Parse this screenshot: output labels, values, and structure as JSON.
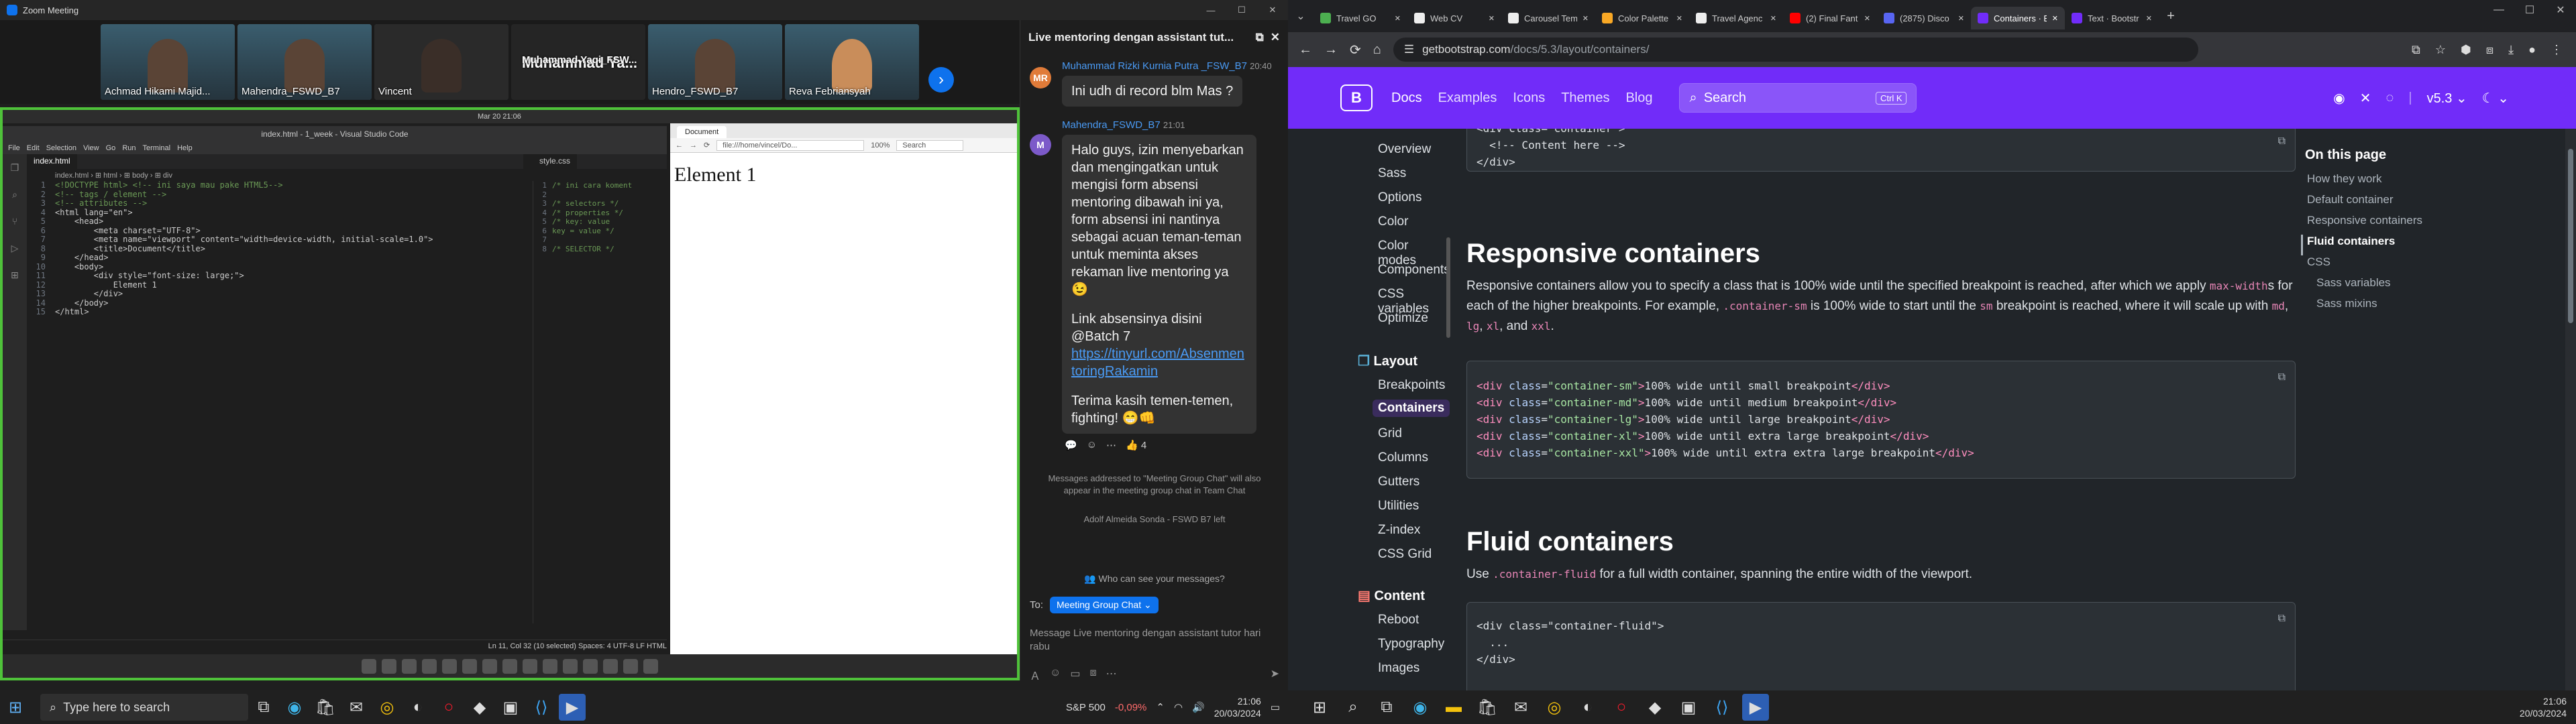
{
  "zoom": {
    "window_title": "Zoom Meeting",
    "participants": [
      {
        "name": "Achmad Hikami Majid..."
      },
      {
        "name": "Mahendra_FSWD_B7"
      },
      {
        "name": "Vincent"
      },
      {
        "name": "Muhammad  Ya..."
      },
      {
        "name": "Muhammad Yaqi_FSW..."
      },
      {
        "name": "Hendro_FSWD_B7"
      },
      {
        "name": "Reva Febriansyah"
      }
    ],
    "chat": {
      "title": "Live mentoring dengan assistant tut...",
      "msg1": {
        "avatar": "MR",
        "sender": "Muhammad Rizki Kurnia Putra _FSW_B7",
        "time": "20:40",
        "text": "Ini udh di record blm Mas ?"
      },
      "msg2": {
        "avatar": "M",
        "sender": "Mahendra_FSWD_B7",
        "time": "21:01",
        "p1": "Halo guys, izin menyebarkan dan mengingatkan untuk mengisi form absensi mentoring dibawah ini ya, form absensi ini nantinya sebagai acuan teman-teman untuk meminta akses rekaman live mentoring ya 😉",
        "p2": "Link absensinya disini @Batch 7",
        "link": "https://tinyurl.com/AbsenmentoringRakamin",
        "p3": "Terima kasih temen-temen, fighting! 😁👊",
        "reaction": "👍 4"
      },
      "note": "Messages addressed to \"Meeting Group Chat\" will also appear in the meeting group chat in Team Chat",
      "left_note": "Adolf Almeida Sonda - FSWD B7 left",
      "who_can_see": "Who can see your messages?",
      "to_label": "To:",
      "to_value": "Meeting Group Chat ⌄",
      "input_placeholder": "Message Live mentoring dengan assistant tutor hari rabu"
    },
    "share": {
      "clock": "Mar 20  21:06",
      "vscode_title": "index.html - 1_week - Visual Studio Code",
      "menu": [
        "File",
        "Edit",
        "Selection",
        "View",
        "Go",
        "Run",
        "Terminal",
        "Help"
      ],
      "tab1": "index.html",
      "tab2": "style.css",
      "breadcrumb": "index.html › ⊞ html › ⊞ body › ⊞ div",
      "code_lines": [
        "<!DOCTYPE html> <!-- ini saya mau pake HTML5-->",
        "<!-- tags / element -->",
        "<!-- attributes -->",
        "<html lang=\"en\">",
        "    <head>",
        "        <meta charset=\"UTF-8\">",
        "        <meta name=\"viewport\" content=\"width=device-width, initial-scale=1.0\">",
        "        <title>Document</title>",
        "    </head>",
        "    <body>",
        "        <div style=\"font-size: large;\">",
        "            Element 1",
        "        </div>",
        "    </body>",
        "</html>"
      ],
      "css_lines": [
        "/* ini cara koment",
        "",
        "/* selectors */",
        "/* properties */",
        "/* key: value",
        "key = value */",
        "",
        "/* SELECTOR */"
      ],
      "status": "Ln 11, Col 32 (10 selected)   Spaces: 4   UTF-8   LF   HTML",
      "mini_tab": "Document",
      "mini_url": "file:///home/vincel/Do...",
      "mini_zoom": "100%",
      "mini_search": "Search",
      "mini_heading": "Element 1"
    }
  },
  "left_taskbar": {
    "search": "Type here to search",
    "stock": "S&P 500",
    "stock_change": "-0,09%",
    "time": "21:06",
    "date": "20/03/2024"
  },
  "browser": {
    "tabs": [
      {
        "title": "Travel GO",
        "color": "#4caf50"
      },
      {
        "title": "Web CV",
        "color": "#eeeeee"
      },
      {
        "title": "Carousel Tem",
        "color": "#eeeeee"
      },
      {
        "title": "Color Palette",
        "color": "#f9a825"
      },
      {
        "title": "Travel Agenc",
        "color": "#eeeeee"
      },
      {
        "title": "(2) Final Fant",
        "color": "#ff0000"
      },
      {
        "title": "(2875) Disco",
        "color": "#5865f2"
      },
      {
        "title": "Containers · B",
        "color": "#712cf9"
      },
      {
        "title": "Text · Bootstr",
        "color": "#712cf9"
      }
    ],
    "url_host": "getbootstrap.com",
    "url_path": "/docs/5.3/layout/containers/",
    "bs_nav": {
      "brand": "B",
      "links": [
        "Docs",
        "Examples",
        "Icons",
        "Themes",
        "Blog"
      ],
      "search": "Search",
      "search_kbd": "Ctrl K",
      "version": "v5.3"
    },
    "sidebar_top": [
      "Overview",
      "Sass",
      "Options",
      "Color",
      "Color modes",
      "Components",
      "CSS variables",
      "Optimize"
    ],
    "layout_head": "Layout",
    "layout_items": [
      "Breakpoints",
      "Containers",
      "Grid",
      "Columns",
      "Gutters",
      "Utilities",
      "Z-index",
      "CSS Grid"
    ],
    "content_head": "Content",
    "content_items": [
      "Reboot",
      "Typography",
      "Images"
    ],
    "code0": [
      "<div class=\"container\">",
      "  <!-- Content here -->",
      "</div>"
    ],
    "h_responsive": "Responsive containers",
    "p_responsive_1": "Responsive containers allow you to specify a class that is 100% wide until the specified breakpoint is reached, after which we apply",
    "p_responsive_c1": "max-width",
    "p_responsive_2": "s for each of the higher breakpoints. For example,",
    "p_responsive_c2": ".container-sm",
    "p_responsive_3": "is 100% wide to start until the",
    "p_responsive_c3": "sm",
    "p_responsive_4": "breakpoint is reached, where it will scale up with",
    "p_responsive_c4": "md",
    "p_responsive_c5": "lg",
    "p_responsive_c6": "xl",
    "p_responsive_and": ", and",
    "p_responsive_c7": "xxl",
    "code1": [
      {
        "cls": "container-sm",
        "text": "100% wide until small breakpoint"
      },
      {
        "cls": "container-md",
        "text": "100% wide until medium breakpoint"
      },
      {
        "cls": "container-lg",
        "text": "100% wide until large breakpoint"
      },
      {
        "cls": "container-xl",
        "text": "100% wide until extra large breakpoint"
      },
      {
        "cls": "container-xxl",
        "text": "100% wide until extra extra large breakpoint"
      }
    ],
    "h_fluid": "Fluid containers",
    "p_fluid_1": "Use",
    "p_fluid_c": ".container-fluid",
    "p_fluid_2": "for a full width container, spanning the entire width of the viewport.",
    "code2": [
      "<div class=\"container-fluid\">",
      "  ...",
      "</div>"
    ],
    "on_this_page": {
      "title": "On this page",
      "items": [
        "How they work",
        "Default container",
        "Responsive containers",
        "Fluid containers",
        "CSS",
        "Sass variables",
        "Sass mixins"
      ]
    }
  },
  "right_taskbar": {
    "time": "21:06",
    "date": "20/03/2024"
  }
}
